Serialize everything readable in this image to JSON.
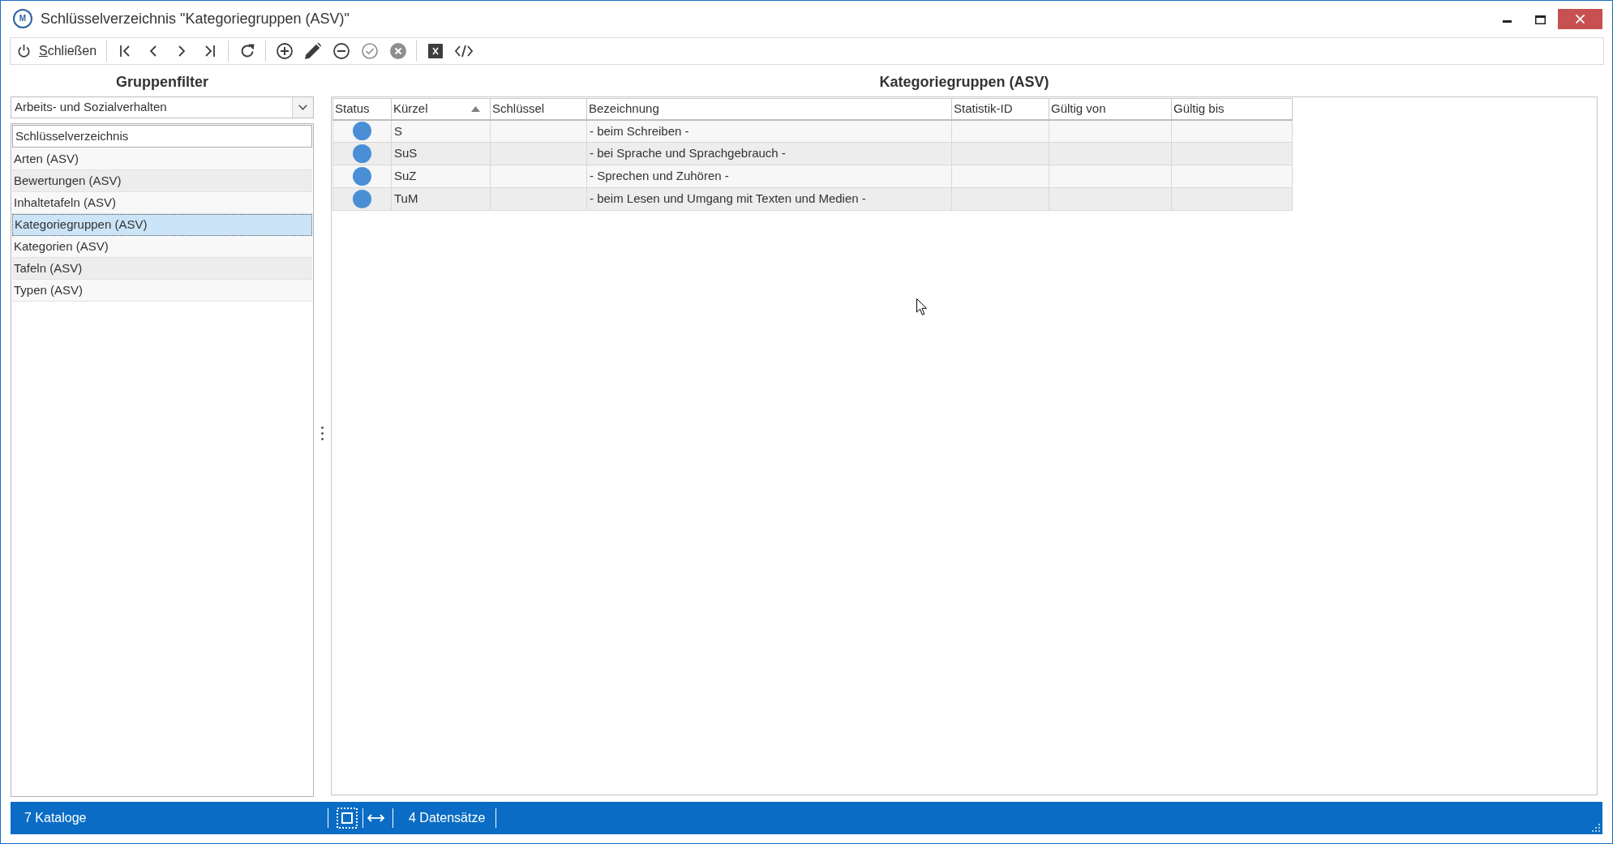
{
  "window": {
    "app_logo": "M",
    "title": "Schlüsselverzeichnis \"Kategoriegruppen (ASV)\""
  },
  "toolbar": {
    "close_button": {
      "label": "Schließen"
    },
    "groups": [
      [
        {
          "kind": "first",
          "disabled": false
        },
        {
          "kind": "previous",
          "disabled": false
        },
        {
          "kind": "next",
          "disabled": false
        },
        {
          "kind": "last",
          "disabled": false
        }
      ],
      [
        {
          "kind": "refresh",
          "disabled": false
        }
      ],
      [
        {
          "kind": "add",
          "disabled": false
        },
        {
          "kind": "edit",
          "disabled": false
        },
        {
          "kind": "remove",
          "disabled": false
        },
        {
          "kind": "confirm",
          "disabled": true
        },
        {
          "kind": "cancel",
          "disabled": true
        }
      ],
      [
        {
          "kind": "excel",
          "disabled": false
        },
        {
          "kind": "code",
          "disabled": false
        }
      ]
    ]
  },
  "group_filter": {
    "title": "Gruppenfilter",
    "dropdown": {
      "value": "Arbeits- und Sozialverhalten"
    },
    "list": {
      "header": "Schlüsselverzeichnis",
      "items": [
        {
          "label": "Arten (ASV)",
          "selected": false
        },
        {
          "label": "Bewertungen (ASV)",
          "selected": false
        },
        {
          "label": "Inhaltetafeln (ASV)",
          "selected": false
        },
        {
          "label": "Kategoriegruppen (ASV)",
          "selected": true
        },
        {
          "label": "Kategorien (ASV)",
          "selected": false
        },
        {
          "label": "Tafeln (ASV)",
          "selected": false
        },
        {
          "label": "Typen (ASV)",
          "selected": false
        }
      ]
    }
  },
  "grid": {
    "title": "Kategoriegruppen (ASV)",
    "columns": [
      {
        "label": "Status",
        "sorted": false
      },
      {
        "label": "Kürzel",
        "sorted": true
      },
      {
        "label": "Schlüssel",
        "sorted": false
      },
      {
        "label": "Bezeichnung",
        "sorted": false
      },
      {
        "label": "Statistik-ID",
        "sorted": false
      },
      {
        "label": "Gültig von",
        "sorted": false
      },
      {
        "label": "Gültig bis",
        "sorted": false
      }
    ],
    "rows": [
      {
        "color": "#4a8fd5",
        "kuerzel": "S",
        "bezeichnung": "- beim Schreiben -"
      },
      {
        "color": "#4a8fd5",
        "kuerzel": "SuS",
        "bezeichnung": "- bei Sprache und Sprachgebrauch -"
      },
      {
        "color": "#4a8fd5",
        "kuerzel": "SuZ",
        "bezeichnung": "- Sprechen und Zuhören -"
      },
      {
        "color": "#4a8fd5",
        "kuerzel": "TuM",
        "bezeichnung": "- beim Lesen und Umgang mit Texten und Medien -"
      }
    ]
  },
  "status_bar": {
    "catalogs": "7 Kataloge",
    "records": "4 Datensätze"
  }
}
